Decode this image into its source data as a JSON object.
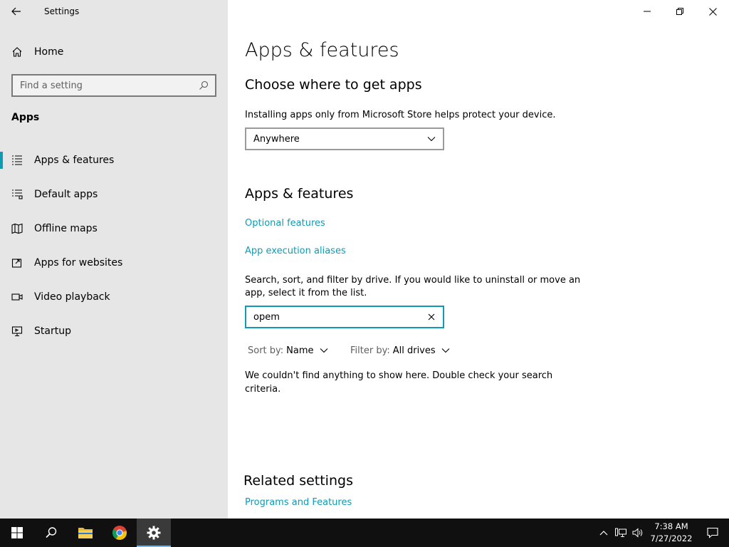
{
  "window": {
    "title": "Settings"
  },
  "sidebar": {
    "home_label": "Home",
    "search_placeholder": "Find a setting",
    "section_title": "Apps",
    "items": [
      {
        "label": "Apps & features",
        "icon": "list-icon"
      },
      {
        "label": "Default apps",
        "icon": "default-apps-icon"
      },
      {
        "label": "Offline maps",
        "icon": "map-icon"
      },
      {
        "label": "Apps for websites",
        "icon": "open-external-icon"
      },
      {
        "label": "Video playback",
        "icon": "video-icon"
      },
      {
        "label": "Startup",
        "icon": "startup-icon"
      }
    ]
  },
  "main": {
    "page_title": "Apps & features",
    "choose_heading": "Choose where to get apps",
    "choose_description": "Installing apps only from Microsoft Store helps protect your device.",
    "source_dropdown_value": "Anywhere",
    "features_heading": "Apps & features",
    "links": {
      "optional_features": "Optional features",
      "app_execution_aliases": "App execution aliases"
    },
    "search_description_line1": "Search, sort, and filter by drive. If you would like to uninstall or move an",
    "search_description_line2": "app, select it from the list.",
    "app_search_value": "opem",
    "sort_label": "Sort by:",
    "sort_value": "Name",
    "filter_label": "Filter by:",
    "filter_value": "All drives",
    "empty_line1": "We couldn't find anything to show here. Double check your search",
    "empty_line2": "criteria.",
    "related_heading": "Related settings",
    "related_link": "Programs and Features"
  },
  "taskbar": {
    "time": "7:38 AM",
    "date": "7/27/2022"
  },
  "colors": {
    "accent": "#0e9cb5",
    "sidebar_bg": "#e6e6e6",
    "taskbar_bg": "#101010"
  }
}
